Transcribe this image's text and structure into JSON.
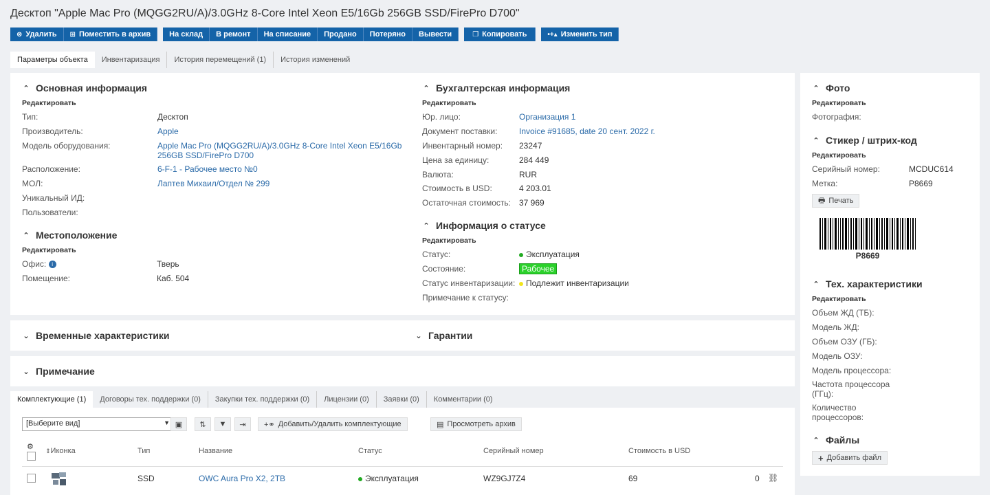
{
  "title": "Десктоп \"Apple Mac Pro (MQGG2RU/A)/3.0GHz 8-Core Intel Xeon E5/16Gb 256GB SSD/FirePro D700\"",
  "toolbar": {
    "delete": "Удалить",
    "archive": "Поместить в архив",
    "to_stock": "На склад",
    "to_repair": "В ремонт",
    "write_off": "На списание",
    "sold": "Продано",
    "lost": "Потеряно",
    "withdraw": "Вывести",
    "copy": "Копировать",
    "change_type": "Изменить тип"
  },
  "tabs": [
    "Параметры объекта",
    "Инвентаризация",
    "История перемещений (1)",
    "История изменений"
  ],
  "main_info": {
    "title": "Основная информация",
    "edit": "Редактировать",
    "rows": [
      {
        "label": "Тип:",
        "value": "Десктоп"
      },
      {
        "label": "Производитель:",
        "value": "Apple"
      },
      {
        "label": "Модель оборудования:",
        "value": "Apple Mac Pro (MQGG2RU/A)/3.0GHz 8-Core Intel Xeon E5/16Gb",
        "value2": "256GB SSD/FirePro D700"
      },
      {
        "label": "Расположение:",
        "value": "6-F-1 - Рабочее место №0"
      },
      {
        "label": "МОЛ:",
        "value": "Лаптев Михаил/Отдел № 299"
      },
      {
        "label": "Уникальный ИД:",
        "value": ""
      },
      {
        "label": "Пользователи:",
        "value": ""
      }
    ]
  },
  "location": {
    "title": "Местоположение",
    "edit": "Редактировать",
    "office_label": "Офис:",
    "office_value": "Тверь",
    "room_label": "Помещение:",
    "room_value": "Каб. 504"
  },
  "accounting": {
    "title": "Бухгалтерская информация",
    "edit": "Редактировать",
    "rows": [
      {
        "label": "Юр. лицо:",
        "value": "Организация 1"
      },
      {
        "label": "Документ поставки:",
        "value": "Invoice #91685, date 20 сент. 2022 г."
      },
      {
        "label": "Инвентарный номер:",
        "value": "23247"
      },
      {
        "label": "Цена за единицу:",
        "value": "284 449"
      },
      {
        "label": "Валюта:",
        "value": "RUR"
      },
      {
        "label": "Стоимость в USD:",
        "value": "4 203.01"
      },
      {
        "label": "Остаточная стоимость:",
        "value": "37 969"
      }
    ]
  },
  "status_info": {
    "title": "Информация о статусе",
    "edit": "Редактировать",
    "status_label": "Статус:",
    "status_value": "Эксплуатация",
    "status_color": "#22aa22",
    "state_label": "Состояние:",
    "state_value": "Рабочее",
    "inv_label": "Статус инвентаризации:",
    "inv_value": "Подлежит инвентаризации",
    "inv_color": "#f2e51c",
    "note_label": "Примечание к статусу:"
  },
  "photo": {
    "title": "Фото",
    "edit": "Редактировать",
    "photo_label": "Фотография:"
  },
  "sticker": {
    "title": "Стикер / штрих-код",
    "edit": "Редактировать",
    "serial_label": "Серийный номер:",
    "serial_value": "MCDUC614",
    "tag_label": "Метка:",
    "tag_value": "P8669",
    "print": "Печать",
    "barcode_text": "P8669"
  },
  "specs": {
    "title": "Тех. характеристики",
    "edit": "Редактировать",
    "rows": [
      "Объем ЖД (ТБ):",
      "Модель ЖД:",
      "Объем ОЗУ (ГБ):",
      "Модель ОЗУ:",
      "Модель процессора:"
    ],
    "cpu_freq_1": "Частота процессора",
    "cpu_freq_2": "(ГГц):",
    "cpu_count_1": "Количество",
    "cpu_count_2": "процессоров:"
  },
  "files": {
    "title": "Файлы",
    "add": "Добавить файл"
  },
  "temporal": "Временные характеристики",
  "warranty": "Гарантии",
  "note": "Примечание",
  "bottom_tabs": [
    "Комплектующие (1)",
    "Договоры тех. поддержки (0)",
    "Закупки тех. поддержки (0)",
    "Лицензии (0)",
    "Заявки (0)",
    "Комментарии (0)"
  ],
  "grid": {
    "view_placeholder": "[Выберите вид]",
    "add_remove": "Добавить/Удалить комплектующие",
    "view_archive": "Просмотреть архив",
    "columns": [
      "Иконка",
      "Тип",
      "Название",
      "Статус",
      "Серийный номер",
      "Стоимость в USD"
    ],
    "row": {
      "type": "SSD",
      "name": "OWC Aura Pro X2, 2TB",
      "status": "Эксплуатация",
      "serial": "WZ9GJ7Z4",
      "cost": "69",
      "extra": "0"
    }
  }
}
